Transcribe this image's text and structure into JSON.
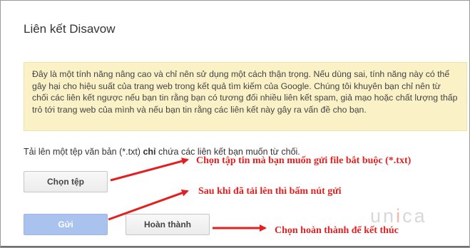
{
  "dialog": {
    "title": "Liên kết Disavow",
    "warning_text": "Đây là một tính năng nâng cao và chỉ nên sử dụng một cách thận trọng. Nếu dùng sai, tính năng này có thể gây hại cho hiệu suất của trang web trong kết quả tìm kiếm của Google. Chúng tôi khuyên bạn chỉ nên từ chối các liên kết ngược nếu bạn tin rằng bạn có tương đối nhiều liên kết spam, giả mạo hoặc chất lượng thấp trỏ tới trang web của mình và nếu bạn tin rằng các liên kết này gây ra vấn đề cho bạn.",
    "upload_prefix": "Tải lên một tệp văn bản (*.txt) ",
    "upload_bold": "chỉ",
    "upload_suffix": " chứa các liên kết bạn muốn từ chối.",
    "choose_file_label": "Chọn tệp",
    "send_label": "Gửi",
    "done_label": "Hoàn thành"
  },
  "annotations": {
    "note_choose": "Chọn tập tin mà bạn muốn gửi file bắt buộc (*.txt)",
    "note_send": "Sau khi đã tải lên thì bấm nút gửi",
    "note_done": "Chọn hoàn thành để kết thúc",
    "color": "#e32020"
  },
  "watermark": {
    "text": "unica"
  },
  "colors": {
    "warning_bg": "#fbf1c7",
    "send_button_bg": "#a9c2ee"
  }
}
